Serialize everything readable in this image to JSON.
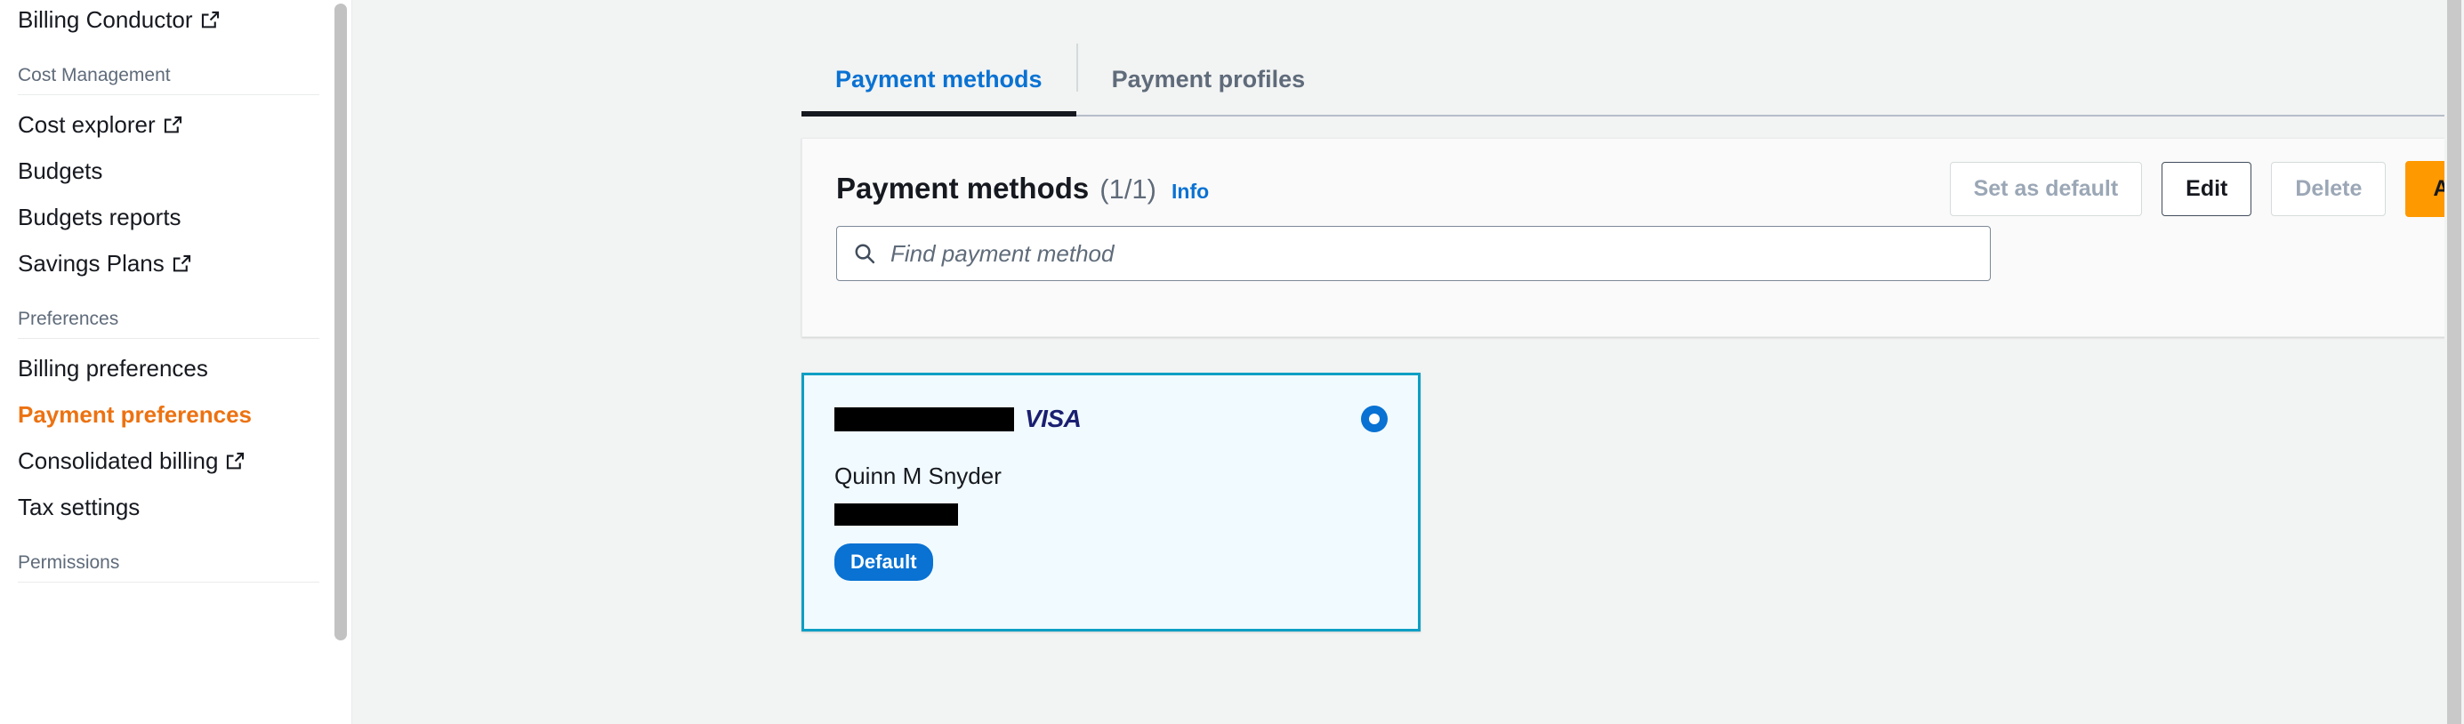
{
  "sidebar": {
    "top_links": [
      {
        "label": "Billing Conductor",
        "external": true
      }
    ],
    "sections": [
      {
        "title": "Cost Management",
        "items": [
          {
            "label": "Cost explorer",
            "external": true,
            "active": false
          },
          {
            "label": "Budgets",
            "external": false,
            "active": false
          },
          {
            "label": "Budgets reports",
            "external": false,
            "active": false
          },
          {
            "label": "Savings Plans",
            "external": true,
            "active": false
          }
        ]
      },
      {
        "title": "Preferences",
        "items": [
          {
            "label": "Billing preferences",
            "external": false,
            "active": false
          },
          {
            "label": "Payment preferences",
            "external": false,
            "active": true
          },
          {
            "label": "Consolidated billing",
            "external": true,
            "active": false
          },
          {
            "label": "Tax settings",
            "external": false,
            "active": false
          }
        ]
      },
      {
        "title": "Permissions",
        "items": []
      }
    ],
    "active_color": "#ec7211"
  },
  "tabs": [
    {
      "label": "Payment methods",
      "active": true
    },
    {
      "label": "Payment profiles",
      "active": false
    }
  ],
  "panel": {
    "title": "Payment methods",
    "count": "(1/1)",
    "info_label": "Info",
    "actions": [
      {
        "label": "Set as default",
        "state": "disabled"
      },
      {
        "label": "Edit",
        "state": "normal"
      },
      {
        "label": "Delete",
        "state": "disabled"
      },
      {
        "label": "Add payment method",
        "state": "primary"
      }
    ],
    "search": {
      "placeholder": "Find payment method",
      "value": ""
    }
  },
  "payment_card": {
    "card_number": "",
    "brand": "VISA",
    "holder_name": "Quinn M Snyder",
    "expiry": "",
    "badge": "Default",
    "selected": true,
    "border_color": "#0d9fc4",
    "background_color": "#f1faff",
    "brand_color": "#1a1f71",
    "badge_color": "#0972d3"
  },
  "colors": {
    "accent_blue": "#0972d3",
    "accent_orange": "#ff9900",
    "page_bg": "#f2f3f3"
  }
}
